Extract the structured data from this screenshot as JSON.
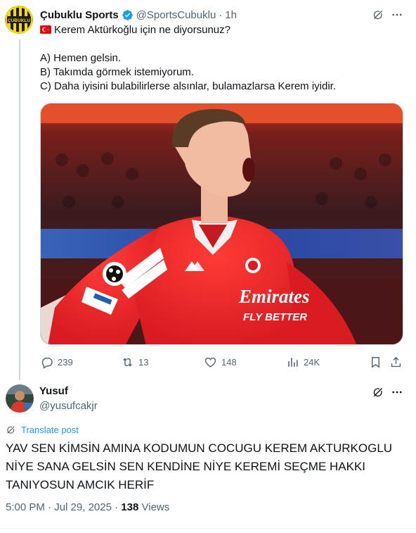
{
  "tweet1": {
    "author_name": "Çubuklu Sports",
    "handle": "@SportsCubuklu",
    "separator": "·",
    "time": "1h",
    "avatar_text": "ÇUBUKLU",
    "question": "Kerem Aktürkoğlu için ne diyorsunuz?",
    "option_a": "A) Hemen gelsin.",
    "option_b": "B) Takımda görmek istemiyorum.",
    "option_c": "C) Daha iyisini bulabilirlerse alsınlar, bulamazlarsa Kerem iyidir.",
    "media_sponsor": "Emirates",
    "media_sponsor_sub": "FLY BETTER",
    "stats": {
      "replies": "239",
      "reposts": "13",
      "likes": "148",
      "views": "24K"
    }
  },
  "tweet2": {
    "author_name": "Yusuf",
    "handle": "@yusufcakjr",
    "translate_label": "Translate post",
    "text": "YAV SEN KİMSİN AMINA KODUMUN COCUGU KEREM AKTURKOGLU NİYE SANA GELSİN SEN KENDİNE NİYE KEREMİ SEÇME HAKKI TANIYOSUN AMCIK HERİF",
    "time": "5:00 PM",
    "date": "Jul 29, 2025",
    "views_count": "138",
    "views_label": "Views"
  },
  "colors": {
    "accent": "#1d9bf0",
    "muted": "#536471",
    "text": "#0f1419",
    "benfica_red": "#e8232a"
  },
  "icons": [
    "verified-badge-icon",
    "grok-icon",
    "more-icon",
    "reply-icon",
    "repost-icon",
    "like-icon",
    "views-icon",
    "bookmark-icon",
    "share-icon",
    "translate-icon",
    "turkey-flag-icon"
  ]
}
